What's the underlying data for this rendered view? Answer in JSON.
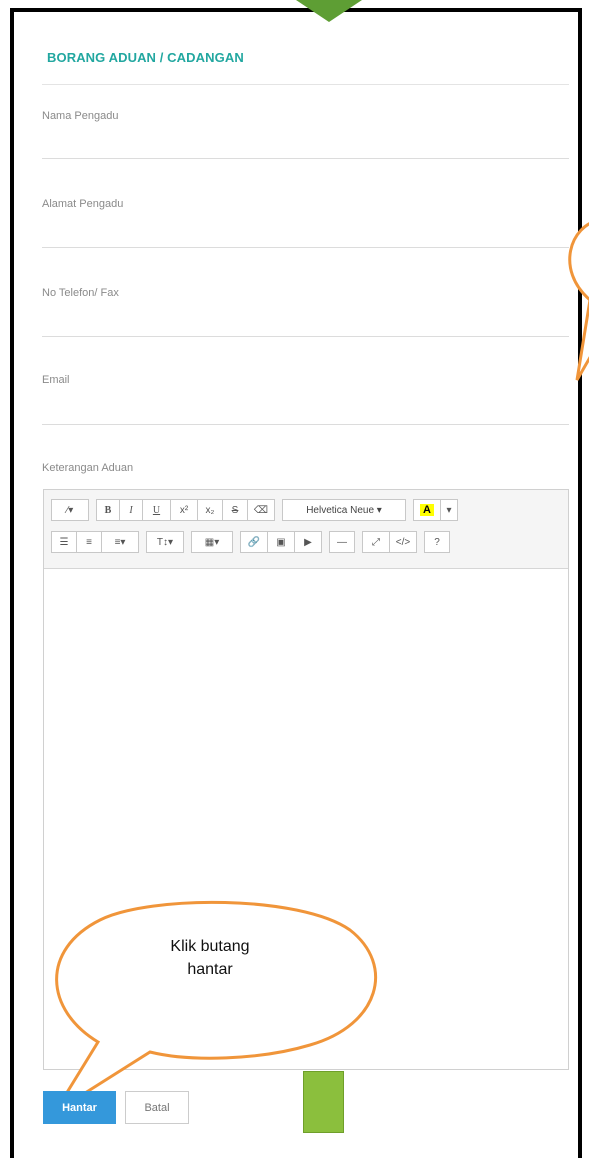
{
  "form": {
    "title": "BORANG ADUAN / CADANGAN",
    "fields": [
      {
        "label": "Nama Pengadu",
        "value": ""
      },
      {
        "label": "Alamat Pengadu",
        "value": ""
      },
      {
        "label": "No Telefon/ Fax",
        "value": ""
      },
      {
        "label": "Email",
        "value": ""
      }
    ],
    "description_label": "Keterangan Aduan"
  },
  "editor": {
    "toolbar_row1": [
      {
        "icon": "magic-wand-icon",
        "text": "⁄▾"
      },
      {
        "icon": "bold-icon",
        "text": "B"
      },
      {
        "icon": "italic-icon",
        "text": "I"
      },
      {
        "icon": "underline-icon",
        "text": "U"
      },
      {
        "icon": "superscript-icon",
        "text": "x²"
      },
      {
        "icon": "subscript-icon",
        "text": "x₂"
      },
      {
        "icon": "strikethrough-icon",
        "text": "S"
      },
      {
        "icon": "eraser-icon",
        "text": "⌫"
      },
      {
        "icon": "font-family-select",
        "text": "Helvetica Neue ▾"
      },
      {
        "icon": "highlight-color-icon",
        "text": "A"
      },
      {
        "icon": "color-dropdown-icon",
        "text": "▾"
      }
    ],
    "toolbar_row2": [
      {
        "icon": "unordered-list-icon",
        "text": "☰"
      },
      {
        "icon": "ordered-list-icon",
        "text": "≡"
      },
      {
        "icon": "align-icon",
        "text": "≡▾"
      },
      {
        "icon": "line-height-icon",
        "text": "T↕▾"
      },
      {
        "icon": "table-icon",
        "text": "▦▾"
      },
      {
        "icon": "link-icon",
        "text": "🔗"
      },
      {
        "icon": "image-icon",
        "text": "▣"
      },
      {
        "icon": "video-icon",
        "text": "▶"
      },
      {
        "icon": "horizontal-rule-icon",
        "text": "—"
      },
      {
        "icon": "fullscreen-icon",
        "text": "⤢"
      },
      {
        "icon": "code-view-icon",
        "text": "</>"
      },
      {
        "icon": "help-icon",
        "text": "?"
      }
    ],
    "content": ""
  },
  "buttons": {
    "submit_label": "Hantar",
    "cancel_label": "Batal"
  },
  "callout": {
    "text_line1": "Klik butang",
    "text_line2": "hantar"
  },
  "colors": {
    "accent": "#22a7a0",
    "submit": "#3498db",
    "bubble_stroke": "#f0953a",
    "arrow": "#5e9e34",
    "green_block": "#8bbf3d"
  }
}
